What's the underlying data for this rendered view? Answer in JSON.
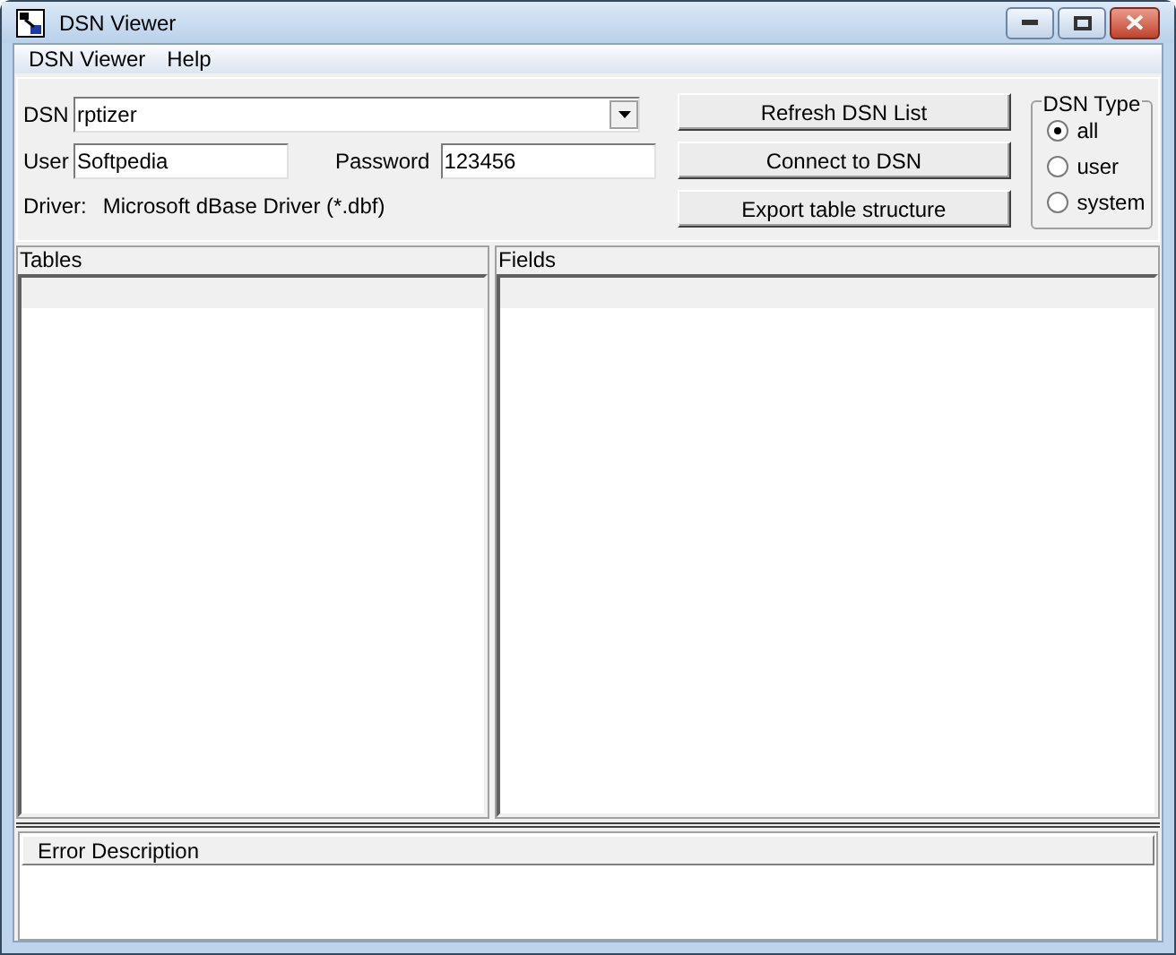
{
  "window": {
    "title": "DSN Viewer"
  },
  "menu": [
    "DSN Viewer",
    "Help"
  ],
  "form": {
    "dsn_label": "DSN",
    "dsn_value": "rptizer",
    "user_label": "User",
    "user_value": "Softpedia",
    "password_label": "Password",
    "password_value": "123456",
    "driver_label": "Driver:",
    "driver_value": "Microsoft dBase Driver (*.dbf)"
  },
  "buttons": [
    "Refresh DSN List",
    "Connect to DSN",
    "Export table structure"
  ],
  "dsn_type": {
    "title": "DSN Type",
    "options": [
      {
        "label": "all",
        "selected": true
      },
      {
        "label": "user",
        "selected": false
      },
      {
        "label": "system",
        "selected": false
      }
    ]
  },
  "panels": [
    {
      "title": "Tables"
    },
    {
      "title": "Fields"
    }
  ],
  "error_panel": {
    "column": "Error Description"
  }
}
